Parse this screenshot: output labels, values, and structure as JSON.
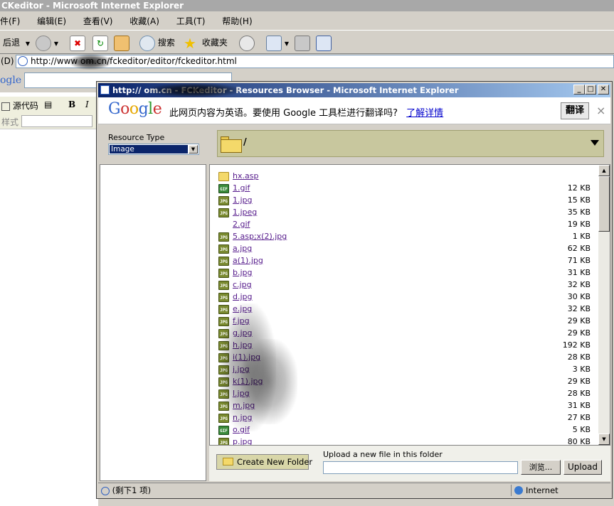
{
  "outer_window": {
    "title": "CKeditor - Microsoft Internet Explorer",
    "menu": [
      "件(F)",
      "编辑(E)",
      "查看(V)",
      "收藏(A)",
      "工具(T)",
      "帮助(H)"
    ],
    "toolbar": {
      "back_label": "后退",
      "search_label": "搜索",
      "favorites_label": "收藏夹"
    },
    "address_prefix": "(D)",
    "address_url": "http://www          om.cn/fckeditor/editor/fckeditor.html",
    "google_partial": "ogle",
    "editor": {
      "source_label": "源代码",
      "bold_label": "B",
      "italic_label": "I",
      "style_label": "样式"
    }
  },
  "popup": {
    "title": "http://             om.cn - FCKeditor - Resources Browser - Microsoft Internet Explorer",
    "translate_bar": {
      "logo": "Google",
      "message": "此网页内容为英语。要使用 Google 工具栏进行翻译吗?",
      "learn_more": "了解详情",
      "translate_button": "翻译",
      "close": "×"
    },
    "resource_type_label": "Resource Type",
    "resource_type_value": "Image",
    "path": "/",
    "files": [
      {
        "name": "hx.asp",
        "size": "",
        "type": "folder"
      },
      {
        "name": "1.gif",
        "size": "12 KB",
        "type": "gif"
      },
      {
        "name": "1.jpg",
        "size": "15 KB",
        "type": "jpg"
      },
      {
        "name": "1.jpeg",
        "size": "35 KB",
        "type": "jpg"
      },
      {
        "name": "2.gif",
        "size": "19 KB",
        "type": "blank"
      },
      {
        "name": "5.asp;x(2).jpg",
        "size": "1 KB",
        "type": "jpg"
      },
      {
        "name": "a.jpg",
        "size": "62 KB",
        "type": "jpg"
      },
      {
        "name": "a(1).jpg",
        "size": "71 KB",
        "type": "jpg"
      },
      {
        "name": "b.jpg",
        "size": "31 KB",
        "type": "jpg"
      },
      {
        "name": "c.jpg",
        "size": "32 KB",
        "type": "jpg"
      },
      {
        "name": "d.jpg",
        "size": "30 KB",
        "type": "jpg"
      },
      {
        "name": "e.jpg",
        "size": "32 KB",
        "type": "jpg"
      },
      {
        "name": "f.jpg",
        "size": "29 KB",
        "type": "jpg"
      },
      {
        "name": "g.jpg",
        "size": "29 KB",
        "type": "jpg"
      },
      {
        "name": "h.jpg",
        "size": "192 KB",
        "type": "jpg"
      },
      {
        "name": "i(1).jpg",
        "size": "28 KB",
        "type": "jpg"
      },
      {
        "name": "j.jpg",
        "size": "3 KB",
        "type": "jpg"
      },
      {
        "name": "k(1).jpg",
        "size": "29 KB",
        "type": "jpg"
      },
      {
        "name": "l.jpg",
        "size": "28 KB",
        "type": "jpg"
      },
      {
        "name": "m.jpg",
        "size": "31 KB",
        "type": "jpg"
      },
      {
        "name": "n.jpg",
        "size": "27 KB",
        "type": "jpg"
      },
      {
        "name": "o.gif",
        "size": "5 KB",
        "type": "gif"
      },
      {
        "name": "p.jpg",
        "size": "80 KB",
        "type": "jpg"
      }
    ],
    "create_folder_label": "Create New Folder",
    "upload_label": "Upload a new file in this folder",
    "browse_label": "浏览...",
    "upload_button": "Upload",
    "status_text": "(剩下1 项)",
    "status_zone": "Internet"
  }
}
